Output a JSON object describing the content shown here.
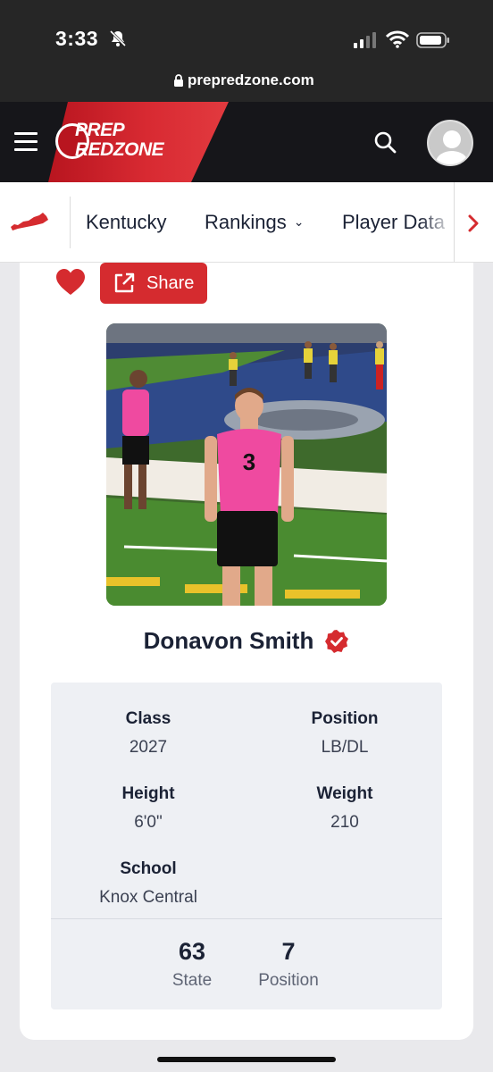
{
  "status_bar": {
    "time": "3:33"
  },
  "browser": {
    "url": "prepredzone.com"
  },
  "header": {
    "logo_line1": "PREP",
    "logo_line2": "REDZONE"
  },
  "nav": {
    "items": [
      {
        "label": "Kentucky"
      },
      {
        "label": "Rankings"
      },
      {
        "label": "Player Data"
      }
    ]
  },
  "actions": {
    "share_label": "Share"
  },
  "player": {
    "name": "Donavon Smith",
    "jersey": "3",
    "class_label": "Class",
    "class_value": "2027",
    "position_label": "Position",
    "position_value": "LB/DL",
    "height_label": "Height",
    "height_value": "6'0\"",
    "weight_label": "Weight",
    "weight_value": "210",
    "school_label": "School",
    "school_value": "Knox Central"
  },
  "rankings": [
    {
      "value": "63",
      "label": "State"
    },
    {
      "value": "7",
      "label": "Position"
    }
  ],
  "colors": {
    "brand_red": "#d52b2f",
    "header_dark": "#16161a",
    "text_dark": "#1b2235"
  }
}
